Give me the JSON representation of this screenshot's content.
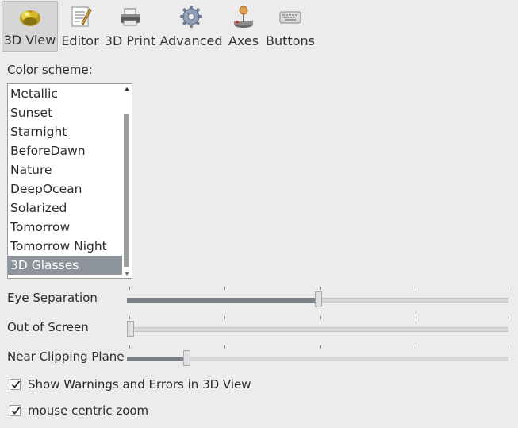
{
  "toolbar": {
    "items": [
      {
        "label": "3D View",
        "icon": "3d-view-icon",
        "active": true
      },
      {
        "label": "Editor",
        "icon": "editor-icon",
        "active": false
      },
      {
        "label": "3D Print",
        "icon": "printer-icon",
        "active": false
      },
      {
        "label": "Advanced",
        "icon": "gear-icon",
        "active": false
      },
      {
        "label": "Axes",
        "icon": "joystick-icon",
        "active": false
      },
      {
        "label": "Buttons",
        "icon": "keyboard-icon",
        "active": false
      }
    ]
  },
  "color_scheme": {
    "label": "Color scheme:",
    "items": [
      "Metallic",
      "Sunset",
      "Starnight",
      "BeforeDawn",
      "Nature",
      "DeepOcean",
      "Solarized",
      "Tomorrow",
      "Tomorrow Night",
      "3D Glasses"
    ],
    "selected": "3D Glasses"
  },
  "sliders": {
    "eye_separation": {
      "label": "Eye Separation",
      "value_fraction": 0.5
    },
    "out_of_screen": {
      "label": "Out of Screen",
      "value_fraction": 0.0
    },
    "near_clipping": {
      "label": "Near Clipping Plane",
      "value_fraction": 0.155
    }
  },
  "checkboxes": {
    "show_warnings": {
      "label": "Show Warnings and Errors in 3D View",
      "checked": true
    },
    "mouse_centric": {
      "label": "mouse centric zoom",
      "checked": true
    }
  },
  "colors": {
    "selection": "#8e949c",
    "slider_fill": "#7a7f86",
    "background": "#ececec"
  }
}
